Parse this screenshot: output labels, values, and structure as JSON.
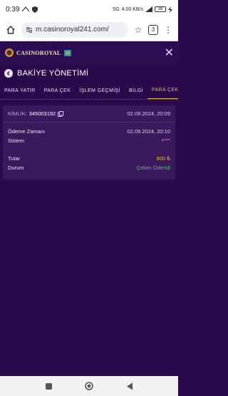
{
  "status_bar": {
    "time": "0:39",
    "network": "5G",
    "speed": "4.00 KB/s",
    "battery": "38"
  },
  "browser": {
    "url": "m.casinoroyal241.com/",
    "tab_count": "3"
  },
  "site": {
    "logo_text": "CASINOROYAL"
  },
  "section": {
    "title": "BAKİYE YÖNETİMİ"
  },
  "tabs": [
    {
      "label": "PARA YATIR"
    },
    {
      "label": "PARA ÇEK"
    },
    {
      "label": "İŞLEM GEÇMİŞİ"
    },
    {
      "label": "BİLGİ"
    },
    {
      "label": "PARA ÇEKME"
    }
  ],
  "transaction": {
    "id_label": "KİMLİK:",
    "id_value": "345003192",
    "created": "02.09.2024, 20:09",
    "payment_time_label": "Ödeme Zamanı",
    "payment_time": "02.09.2024, 20:10",
    "system_label": "Sistem",
    "system_value": "F****",
    "amount_label": "Tutar",
    "amount_value": "800 ₺",
    "status_label": "Durum",
    "status_value": "Çekim Ödendi"
  },
  "colors": {
    "background": "#2a0a4a",
    "card": "#3a1a5c",
    "accent": "#e6b84a",
    "success": "#4fc15a"
  }
}
